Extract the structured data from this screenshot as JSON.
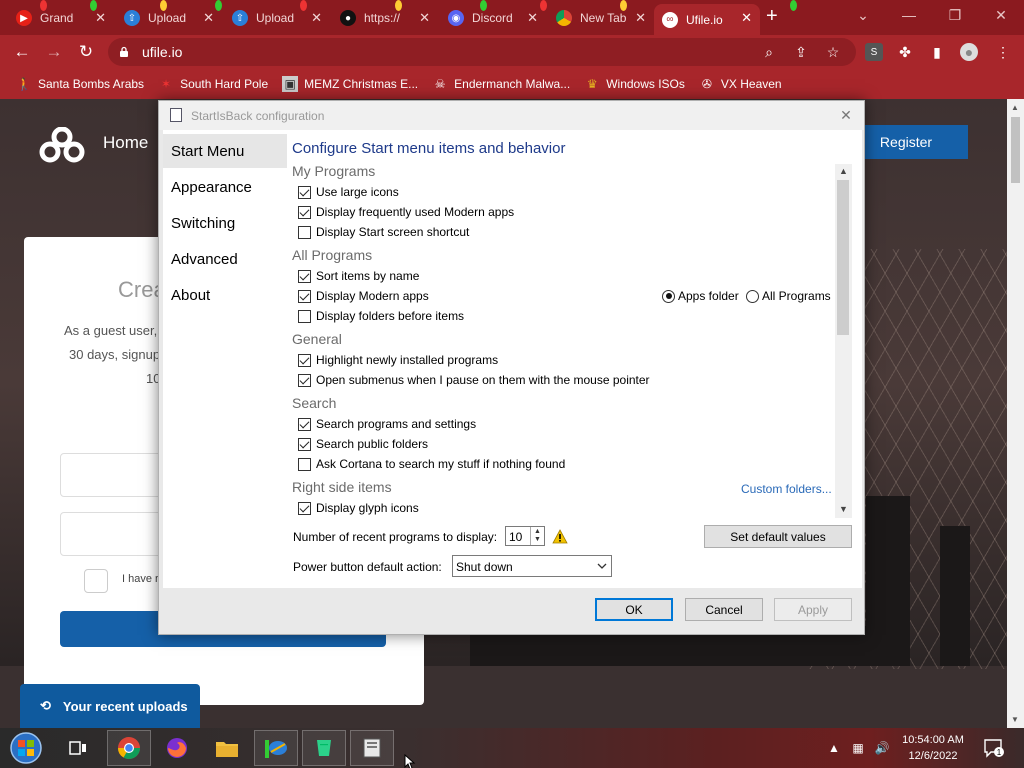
{
  "browser": {
    "tabs": [
      {
        "title": "Grand",
        "icon": "youtube-icon"
      },
      {
        "title": "Upload",
        "icon": "upload-icon"
      },
      {
        "title": "Upload",
        "icon": "upload-icon"
      },
      {
        "title": "https://",
        "icon": "github-icon"
      },
      {
        "title": "Discord",
        "icon": "discord-icon"
      },
      {
        "title": "New Tab",
        "icon": "chrome-icon"
      },
      {
        "title": "Ufile.io",
        "icon": "ufile-icon",
        "active": true
      }
    ],
    "url": "ufile.io",
    "bookmarks": [
      {
        "label": "Santa Bombs Arabs",
        "icon": "walking-icon"
      },
      {
        "label": "South Hard Pole",
        "icon": "maple-leaf-icon"
      },
      {
        "label": "MEMZ Christmas E...",
        "icon": "video-icon"
      },
      {
        "label": "Endermanch Malwa...",
        "icon": "skull-icon"
      },
      {
        "label": "Windows ISOs",
        "icon": "trophy-icon"
      },
      {
        "label": "VX Heaven",
        "icon": "vx-icon"
      }
    ],
    "profile_badge": "S"
  },
  "webpage": {
    "nav_home": "Home",
    "register": "Register",
    "card_title": "Crea",
    "card_line1": "As a guest user,",
    "card_line2": "30 days, signup",
    "card_line3": "10",
    "checkbox_label": "I have r",
    "recent_uploads": "Your recent uploads"
  },
  "dialog": {
    "title": "StartIsBack configuration",
    "sidebar": [
      {
        "label": "Start Menu",
        "selected": true
      },
      {
        "label": "Appearance"
      },
      {
        "label": "Switching"
      },
      {
        "label": "Advanced"
      },
      {
        "label": "About"
      }
    ],
    "heading": "Configure Start menu items and behavior",
    "sections": {
      "my_programs": "My Programs",
      "all_programs": "All Programs",
      "general": "General",
      "search": "Search",
      "right_side": "Right side items"
    },
    "options": {
      "large_icons": "Use large icons",
      "frequent_modern": "Display frequently used Modern apps",
      "start_shortcut": "Display Start screen shortcut",
      "sort_by_name": "Sort items by name",
      "display_modern": "Display Modern apps",
      "folders_before": "Display folders before items",
      "highlight_new": "Highlight newly installed programs",
      "open_submenus": "Open submenus when I pause on them with the mouse pointer",
      "search_programs": "Search programs and settings",
      "search_public": "Search public folders",
      "ask_cortana": "Ask Cortana to search my stuff if nothing found",
      "glyph_icons": "Display glyph icons"
    },
    "radios": {
      "apps_folder": "Apps folder",
      "all_programs": "All Programs"
    },
    "custom_folders": "Custom folders...",
    "recent_label": "Number of recent programs to display:",
    "recent_value": "10",
    "set_defaults": "Set default values",
    "power_label": "Power button default action:",
    "power_value": "Shut down",
    "buttons": {
      "ok": "OK",
      "cancel": "Cancel",
      "apply": "Apply"
    }
  },
  "taskbar": {
    "time": "10:54:00 AM",
    "date": "12/6/2022",
    "notification_count": "1"
  }
}
